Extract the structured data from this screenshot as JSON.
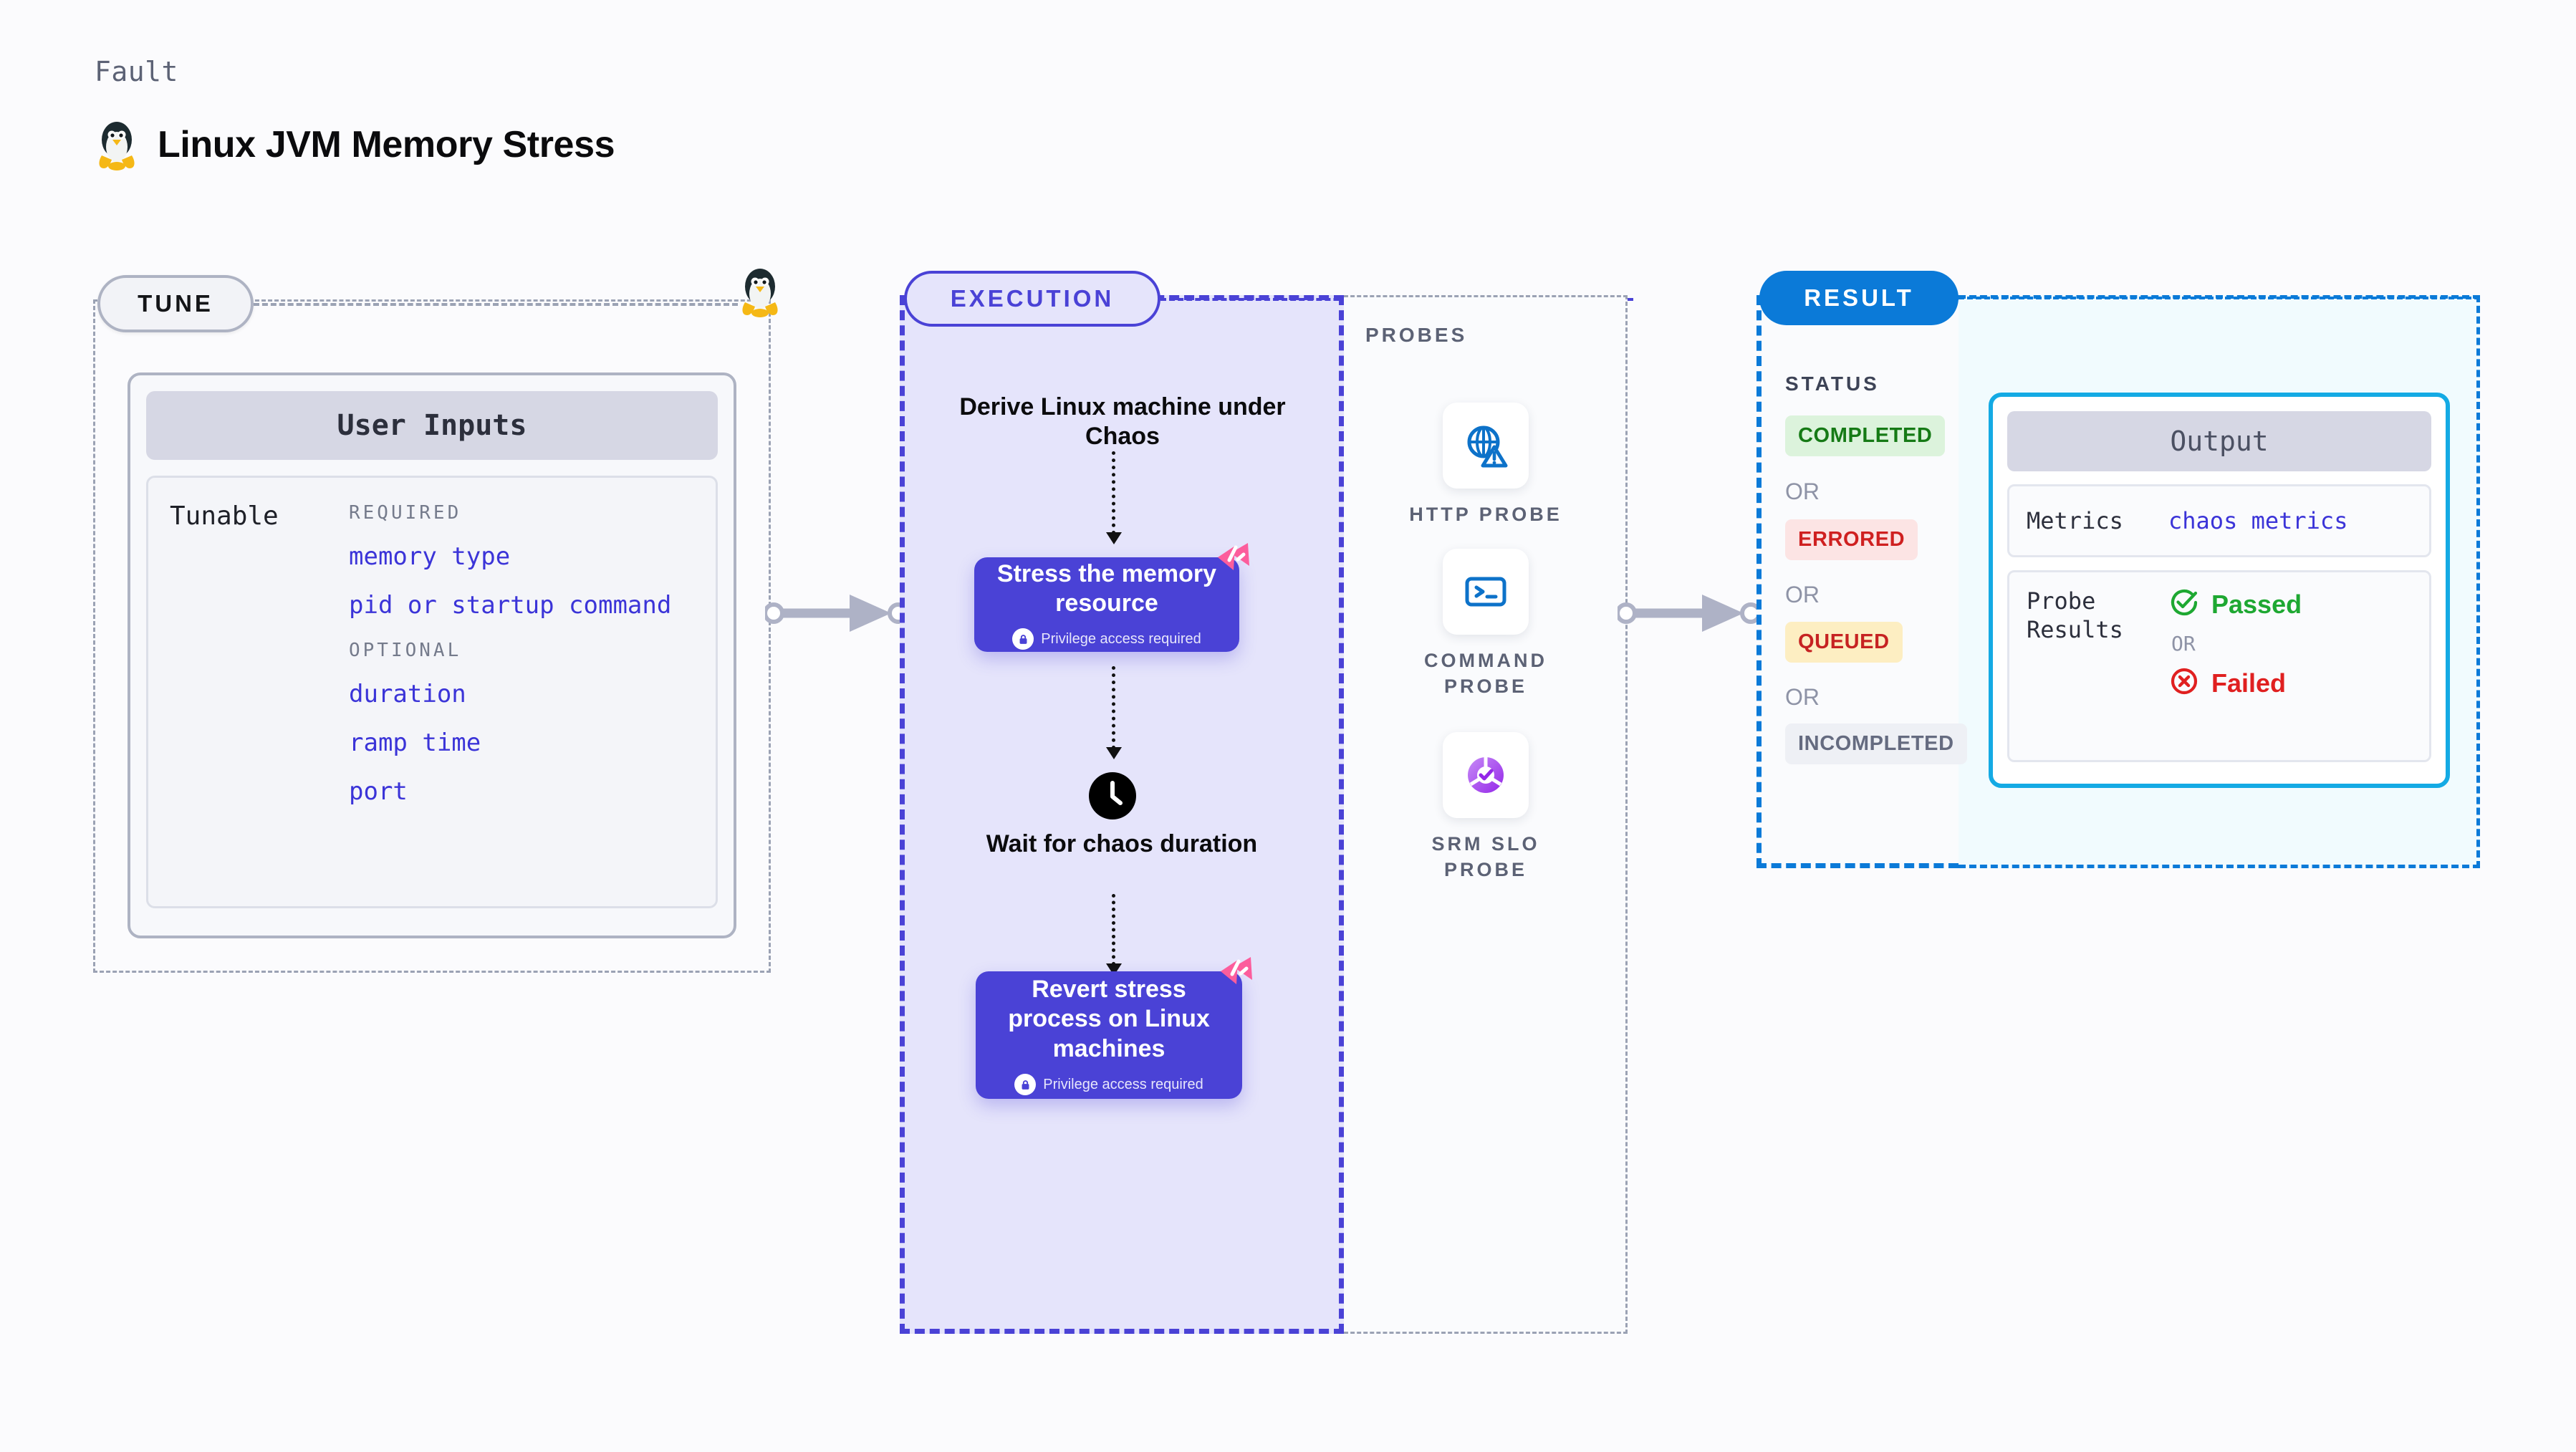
{
  "header": {
    "kind_label": "Fault",
    "title": "Linux JVM Memory Stress",
    "icon": "linux-penguin-icon"
  },
  "stages": {
    "tune": {
      "pill_label": "TUNE"
    },
    "execution": {
      "pill_label": "EXECUTION"
    },
    "result": {
      "pill_label": "RESULT"
    },
    "probes": {
      "section_label": "PROBES"
    }
  },
  "user_inputs": {
    "card_title": "User Inputs",
    "row_label": "Tunable",
    "required_label": "REQUIRED",
    "optional_label": "OPTIONAL",
    "required": [
      "memory type",
      "pid or startup command"
    ],
    "optional": [
      "duration",
      "ramp time",
      "port"
    ]
  },
  "execution_flow": {
    "step1_text": "Derive Linux machine under Chaos",
    "step2": {
      "title": "Stress the memory resource",
      "privilege_note": "Privilege access required",
      "badge": "harness-logo-icon",
      "lock": "lock-icon"
    },
    "step3": {
      "text": "Wait for chaos duration",
      "icon": "clock-icon"
    },
    "step4": {
      "title": "Revert stress process on Linux machines",
      "privilege_note": "Privilege access required",
      "badge": "harness-logo-icon",
      "lock": "lock-icon"
    }
  },
  "probes": [
    {
      "label": "HTTP PROBE",
      "icon": "globe-warning-icon"
    },
    {
      "label": "COMMAND PROBE",
      "icon": "terminal-icon"
    },
    {
      "label": "SRM SLO PROBE",
      "icon": "slo-donut-check-icon"
    }
  ],
  "result": {
    "status_label": "STATUS",
    "or_label": "OR",
    "statuses": [
      {
        "label": "COMPLETED",
        "bg": "#dcf3dc",
        "fg": "#167a16"
      },
      {
        "label": "ERRORED",
        "bg": "#fce4e4",
        "fg": "#cf2020"
      },
      {
        "label": "QUEUED",
        "bg": "#fdeec2",
        "fg": "#c62222"
      },
      {
        "label": "INCOMPLETED",
        "bg": "#eef0f5",
        "fg": "#656b80"
      }
    ],
    "output": {
      "card_title": "Output",
      "metrics_label": "Metrics",
      "metrics_value": "chaos metrics",
      "probe_results_label": "Probe Results",
      "passed_label": "Passed",
      "failed_label": "Failed",
      "or_label": "OR",
      "passed_icon": "check-circle-icon",
      "failed_icon": "x-circle-icon"
    }
  },
  "colors": {
    "accent_purple": "#4a42d6",
    "accent_blue": "#0b7ad8",
    "accent_cyan": "#14aae4",
    "harness_pink": "#fc5d9c",
    "pass_green": "#1ea832",
    "fail_red": "#e02020",
    "code_blue": "#3b34d8",
    "muted_gray": "#8e93a6"
  }
}
